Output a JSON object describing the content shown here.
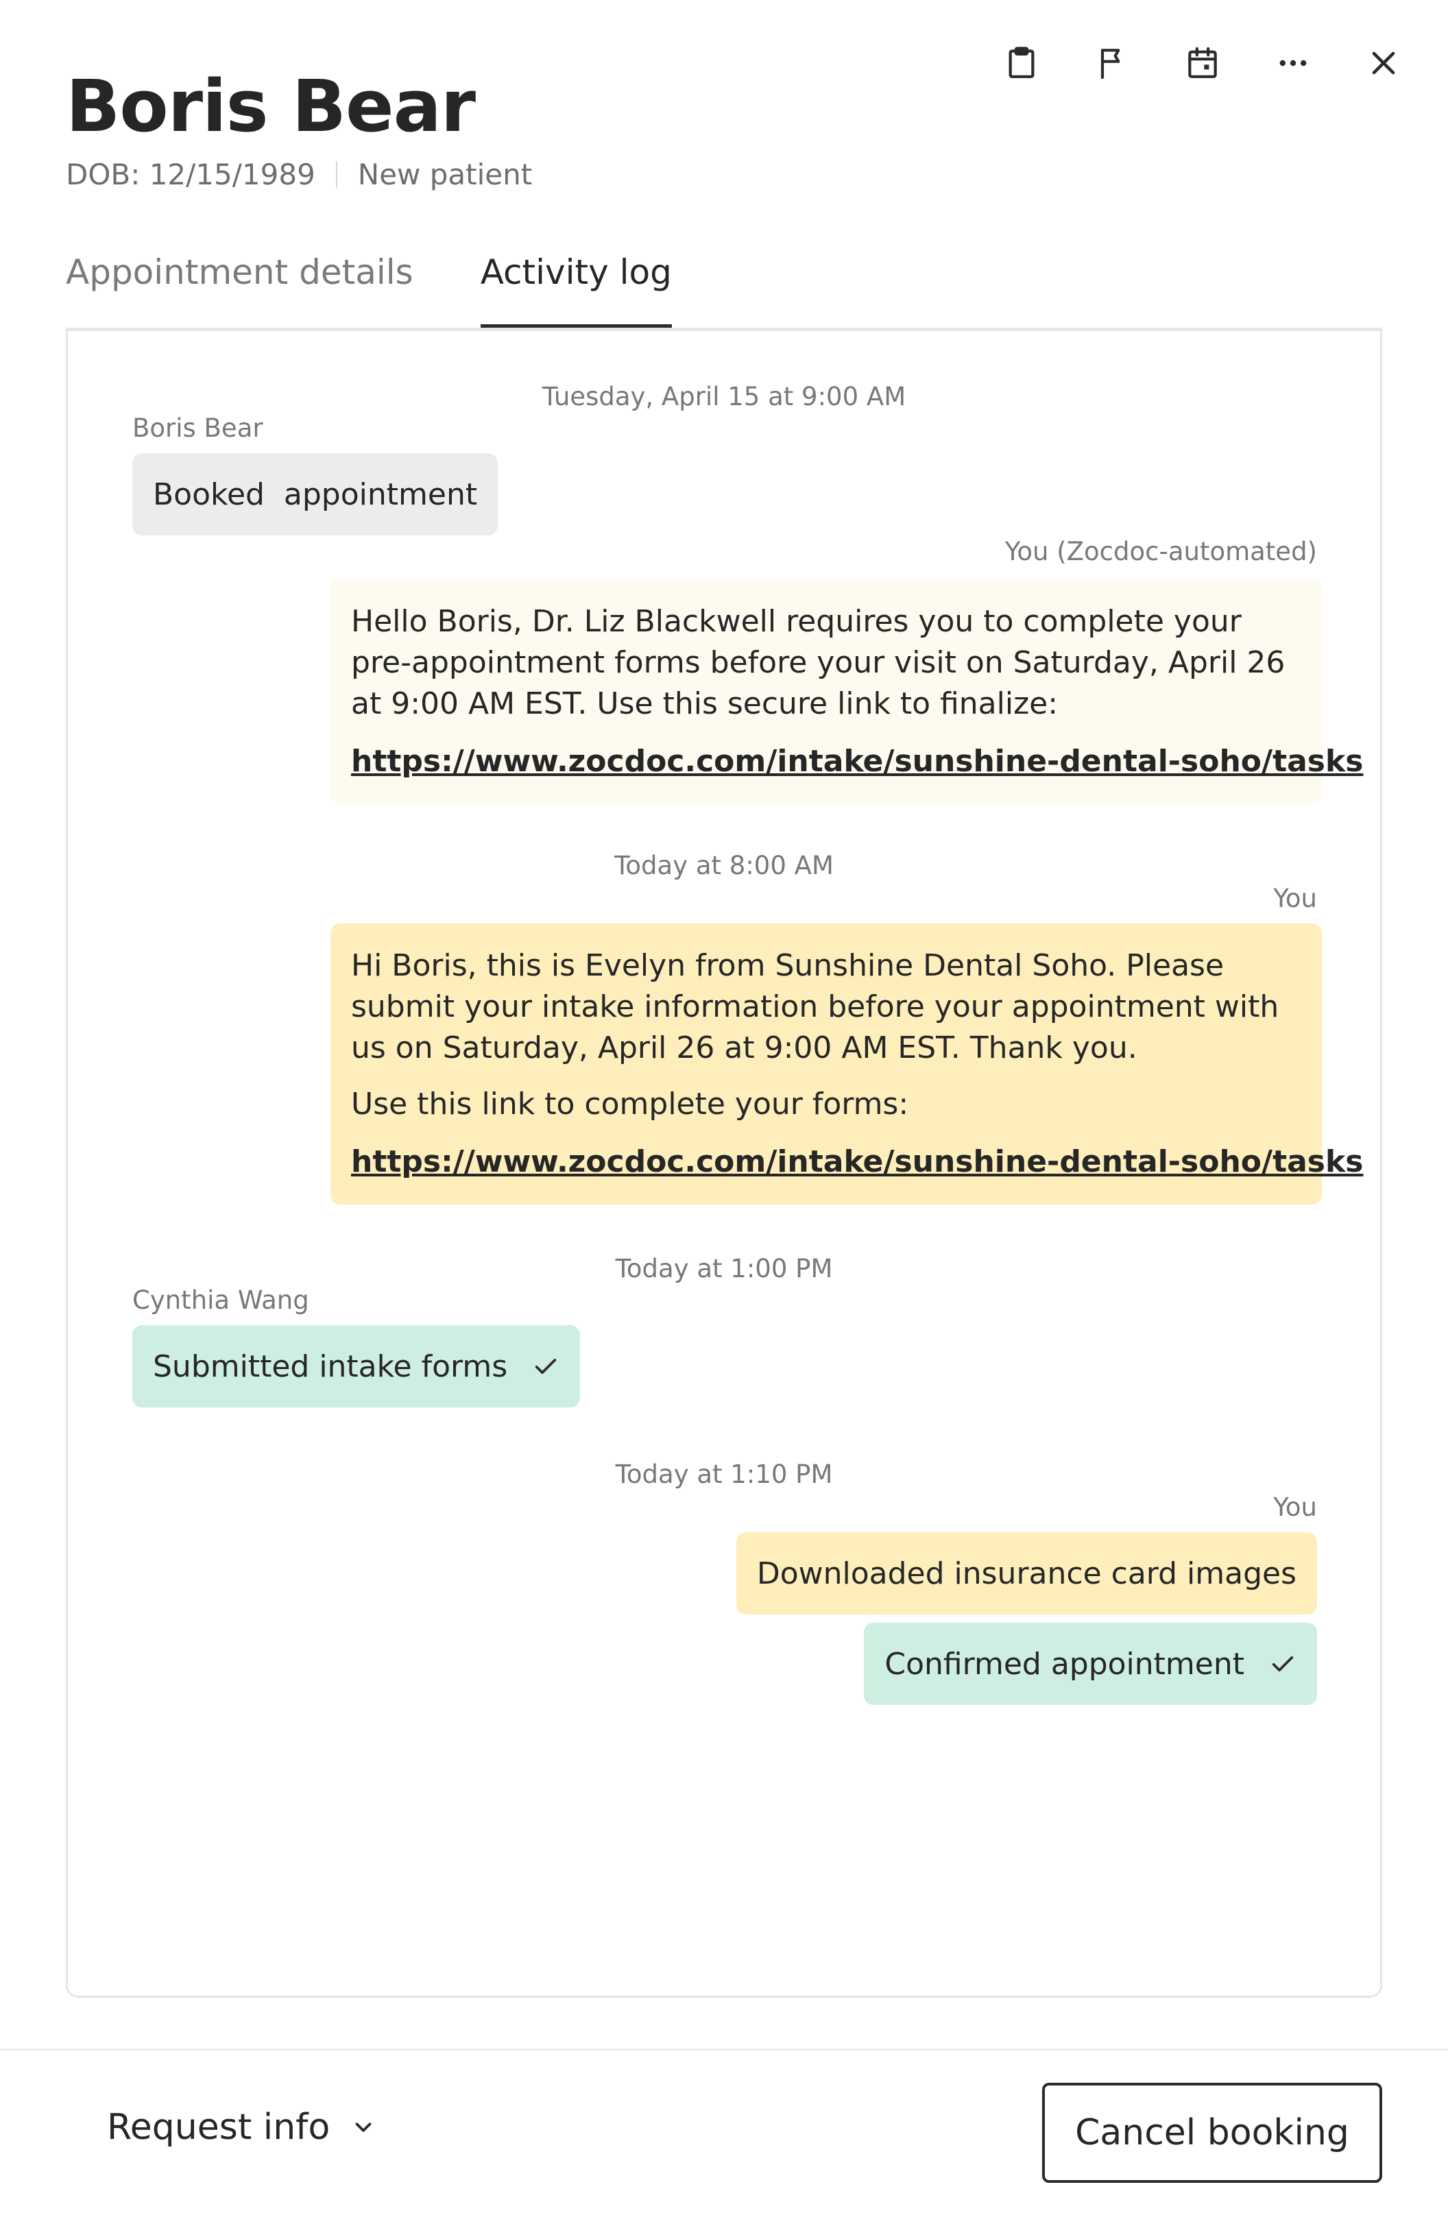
{
  "header": {
    "patient_name": "Boris Bear",
    "dob": "DOB: 12/15/1989",
    "patient_status": "New patient",
    "icons": [
      "clipboard-icon",
      "flag-icon",
      "calendar-icon",
      "more-icon",
      "close-icon"
    ]
  },
  "tabs": [
    {
      "label": "Appointment details",
      "active": false
    },
    {
      "label": "Activity log",
      "active": true
    }
  ],
  "activity_log": {
    "entries": [
      {
        "timestamp": "Tuesday, April 15 at 9:00 AM"
      },
      {
        "author": "Boris Bear",
        "text": "Booked  appointment"
      },
      {
        "author": "You (Zocdoc-automated)",
        "text": "Hello Boris, Dr. Liz Blackwell requires you to complete your pre-appointment forms before your visit on Saturday, April 26 at 9:00 AM EST. Use this secure link to finalize:",
        "link": "https://www.zocdoc.com/intake/sunshine-dental-soho/tasks"
      },
      {
        "timestamp": "Today at 8:00 AM"
      },
      {
        "author": "You",
        "text": "Hi Boris, this is Evelyn from Sunshine Dental Soho. Please submit your intake information before your appointment with us on Saturday, April 26 at 9:00 AM EST. Thank you.",
        "text2": "Use this link to complete your forms:",
        "link": "https://www.zocdoc.com/intake/sunshine-dental-soho/tasks"
      },
      {
        "timestamp": "Today at 1:00 PM"
      },
      {
        "author": "Cynthia Wang",
        "text": "Submitted intake forms",
        "icon": "check-icon"
      },
      {
        "timestamp": "Today at 1:10 PM"
      },
      {
        "author": "You",
        "text": "Downloaded insurance card images"
      },
      {
        "text": "Confirmed appointment",
        "icon": "check-icon"
      }
    ]
  },
  "footer": {
    "request_info_label": "Request info",
    "cancel_label": "Cancel booking"
  },
  "colors": {
    "chip_gray": "#ececec",
    "chip_green": "#cdeee0",
    "bubble_cream": "#fdfbef",
    "bubble_yellow": "#fdeebc",
    "text_dark": "#262626",
    "text_muted": "#787878"
  }
}
